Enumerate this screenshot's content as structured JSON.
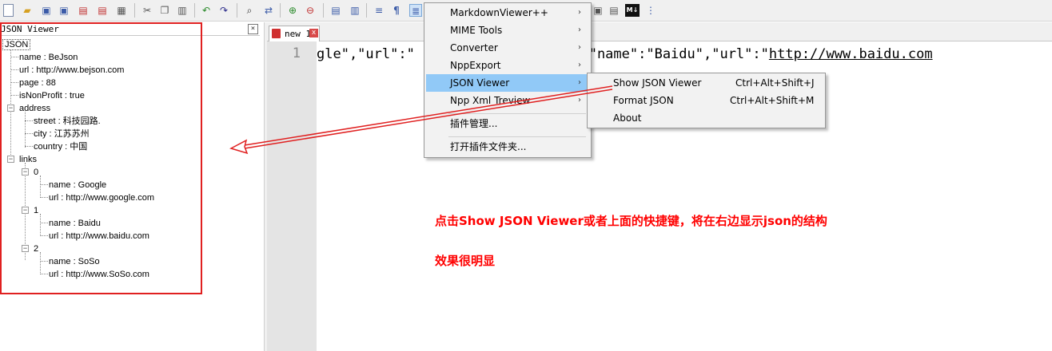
{
  "toolbar": {
    "icons": [
      "new-file",
      "open",
      "save",
      "save-all",
      "close",
      "close-all",
      "print",
      "cut",
      "copy",
      "paste",
      "undo",
      "redo",
      "find",
      "replace",
      "zoom-in",
      "zoom-out",
      "sync-v",
      "sync-h",
      "wrap",
      "show-all",
      "indent-guide",
      "markdown"
    ],
    "pilcrow": "¶",
    "md_badge": "M↓"
  },
  "panel": {
    "title": "JSON Viewer",
    "close": "×"
  },
  "tree": {
    "root": "JSON",
    "name": "name : BeJson",
    "url": "url : http://www.bejson.com",
    "page": "page : 88",
    "isNonProfit": "isNonProfit : true",
    "address": "address",
    "street": "street : 科技园路.",
    "city": "city : 江苏苏州",
    "country": "country : 中国",
    "links": "links",
    "l0": "0",
    "l0_name": "name : Google",
    "l0_url": "url : http://www.google.com",
    "l1": "1",
    "l1_name": "name : Baidu",
    "l1_url": "url : http://www.baidu.com",
    "l2": "2",
    "l2_name": "name : SoSo",
    "l2_url": "url : http://www.SoSo.com"
  },
  "editor": {
    "tab_label": "new 1",
    "tab_close": "x",
    "line_number": "1",
    "code_a": "gle\",\"url\":\"",
    "code_b": ".com\"},{\"name\":\"Baidu\",\"url\":\"",
    "code_link": "http://www.baidu.com"
  },
  "plugins_menu": {
    "items": [
      "MarkdownViewer++",
      "MIME Tools",
      "Converter",
      "NppExport",
      "JSON Viewer",
      "Npp Xml Treview",
      "插件管理...",
      "打开插件文件夹..."
    ],
    "arrow": "›"
  },
  "json_viewer_menu": {
    "items": [
      {
        "label": "Show JSON Viewer",
        "shortcut": "Ctrl+Alt+Shift+J"
      },
      {
        "label": "Format JSON",
        "shortcut": "Ctrl+Alt+Shift+M"
      },
      {
        "label": "About",
        "shortcut": ""
      }
    ]
  },
  "annotations": {
    "line1": "点击Show JSON Viewer或者上面的快捷键，将在右边显示json的结构",
    "line2": "效果很明显"
  },
  "colors": {
    "accent": "#e02020",
    "highlight": "#91c9f7"
  }
}
